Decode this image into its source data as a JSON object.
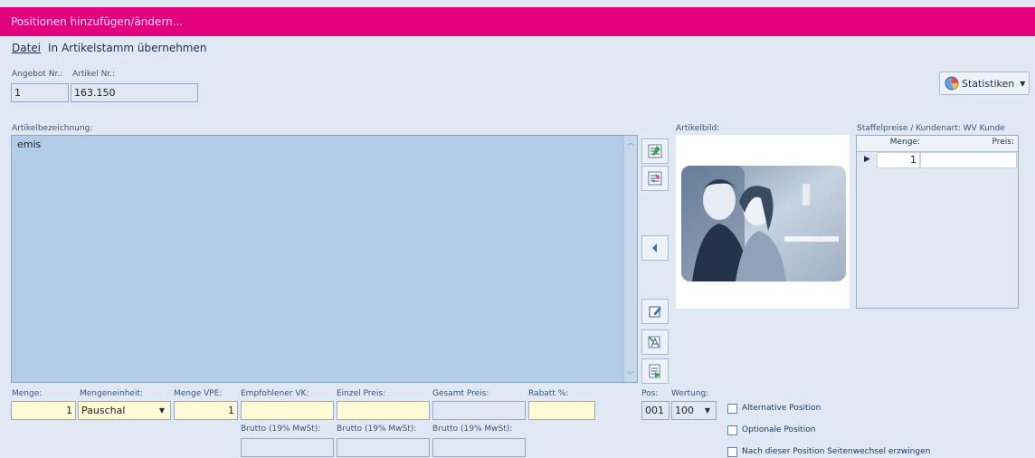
{
  "window": {
    "title": "Positionen hinzufügen/ändern..."
  },
  "menu": {
    "datei": "Datei",
    "artikelstamm": "In Artikelstamm übernehmen"
  },
  "header": {
    "angebot_label": "Angebot Nr.:",
    "angebot_value": "1",
    "artikel_label": "Artikel Nr.:",
    "artikel_value": "163.150",
    "statistiken_label": "Statistiken"
  },
  "description": {
    "label": "Artikelbezeichnung:",
    "value": "emis"
  },
  "side_buttons": [
    "text-format-icon",
    "text-replace-icon",
    "arrow-left-icon",
    "edit-icon",
    "edit-text-icon",
    "insert-text-icon"
  ],
  "image": {
    "label": "Artikelbild:"
  },
  "staffel": {
    "label": "Staffelpreise / Kundenart: WV Kunde",
    "col_menge": "Menge:",
    "col_preis": "Preis:",
    "rows": [
      {
        "menge": "1",
        "preis": ""
      }
    ]
  },
  "bottom": {
    "menge_label": "Menge:",
    "menge_value": "1",
    "einheit_label": "Mengeneinheit:",
    "einheit_value": "Pauschal",
    "vpe_label": "Menge VPE:",
    "vpe_value": "1",
    "empf_label": "Empfohlener VK:",
    "empf_value": "",
    "einzel_label": "Einzel Preis:",
    "einzel_value": "",
    "gesamt_label": "Gesamt Preis:",
    "gesamt_value": "",
    "rabatt_label": "Rabatt %:",
    "rabatt_value": "",
    "brutto_label_1": "Brutto (19% MwSt):",
    "brutto_label_2": "Brutto (19% MwSt):",
    "brutto_label_3": "Brutto (19% MwSt):",
    "pos_label": "Pos:",
    "pos_value": "001",
    "wertung_label": "Wertung:",
    "wertung_value": "100"
  },
  "options": {
    "alternative": "Alternative Position",
    "optionale": "Optionale Position",
    "seitenwechsel": "Nach dieser Position Seitenwechsel erzwingen"
  },
  "colors": {
    "title_bar": "#e3007f",
    "background": "#dfe8f3",
    "text_area": "#b3cde9",
    "yellow_field": "#fffbd6"
  }
}
